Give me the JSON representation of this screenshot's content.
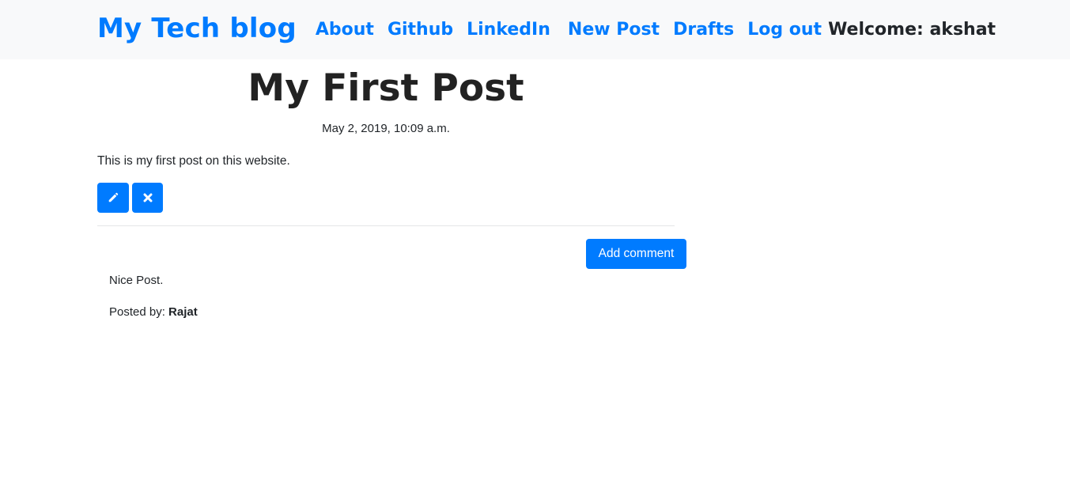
{
  "navbar": {
    "brand": "My Tech blog",
    "links": [
      "About",
      "Github",
      "LinkedIn",
      "New Post",
      "Drafts",
      "Log out"
    ],
    "welcome": "Welcome: akshat"
  },
  "post": {
    "title": "My First Post",
    "date": "May 2, 2019, 10:09 a.m.",
    "body": "This is my first post on this website.",
    "actions": {
      "edit_icon": "pencil-icon",
      "delete_icon": "times-icon"
    }
  },
  "comments": {
    "add_label": "Add comment",
    "items": [
      {
        "text": "Nice Post.",
        "posted_by_label": "Posted by: ",
        "author": "Rajat"
      }
    ]
  },
  "colors": {
    "primary": "#007bff",
    "navbar_bg": "#f8f9fa",
    "text": "#212529"
  }
}
